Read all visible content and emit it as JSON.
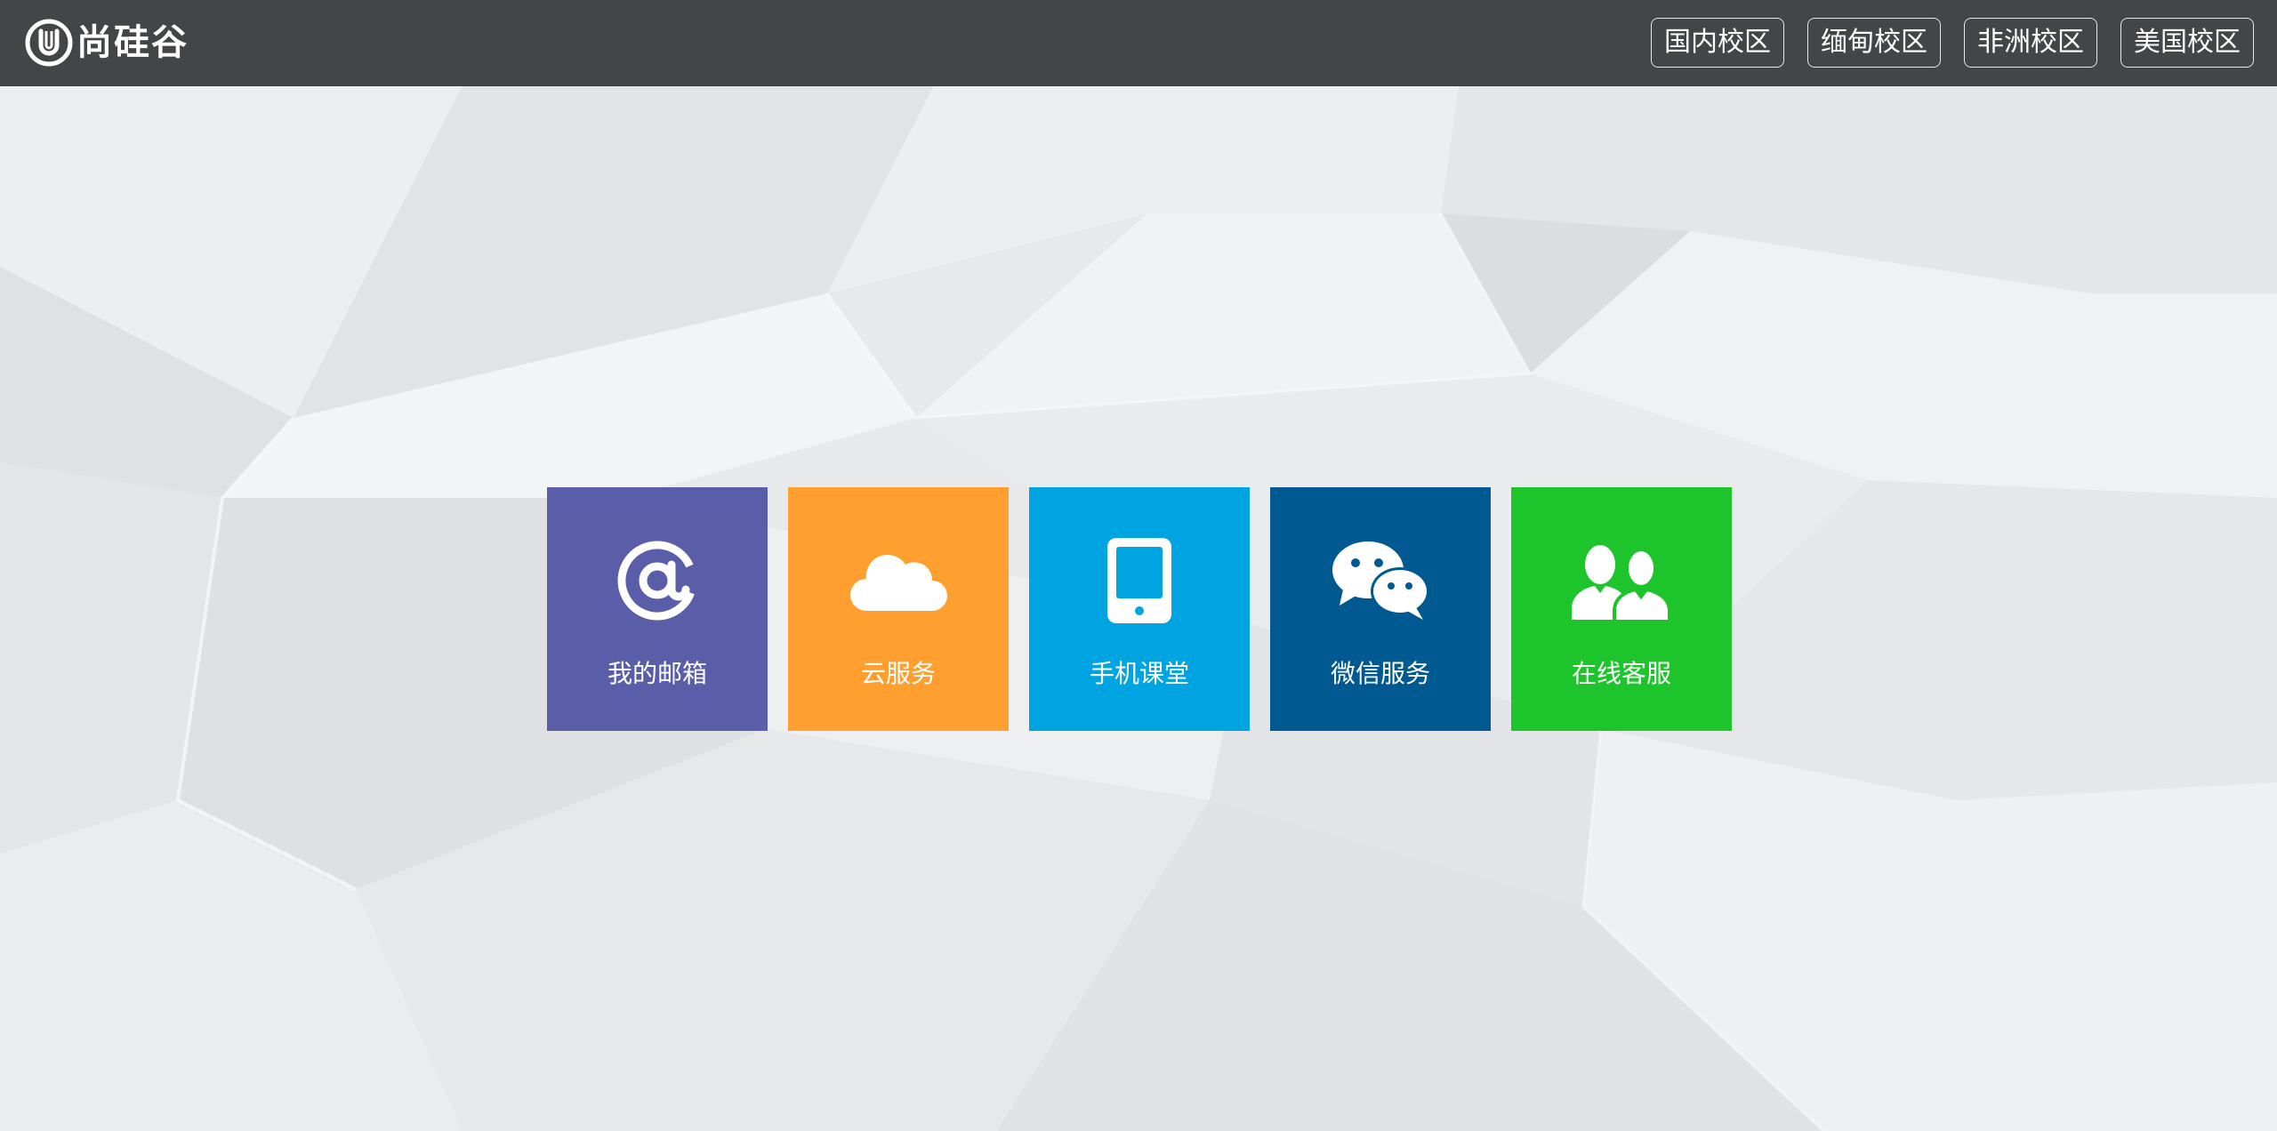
{
  "header": {
    "logo_text": "尚硅谷",
    "campuses": [
      {
        "label": "国内校区"
      },
      {
        "label": "缅甸校区"
      },
      {
        "label": "非洲校区"
      },
      {
        "label": "美国校区"
      }
    ]
  },
  "tiles": [
    {
      "label": "我的邮箱",
      "icon": "at-sign-icon",
      "color": "#5a5da8"
    },
    {
      "label": "云服务",
      "icon": "cloud-icon",
      "color": "#ff9f2f"
    },
    {
      "label": "手机课堂",
      "icon": "mobile-phone-icon",
      "color": "#00a4e0"
    },
    {
      "label": "微信服务",
      "icon": "wechat-icon",
      "color": "#005a91"
    },
    {
      "label": "在线客服",
      "icon": "users-icon",
      "color": "#1dc42b"
    }
  ],
  "colors": {
    "header_bg": "#444547",
    "page_bg": "#e9eaec"
  }
}
